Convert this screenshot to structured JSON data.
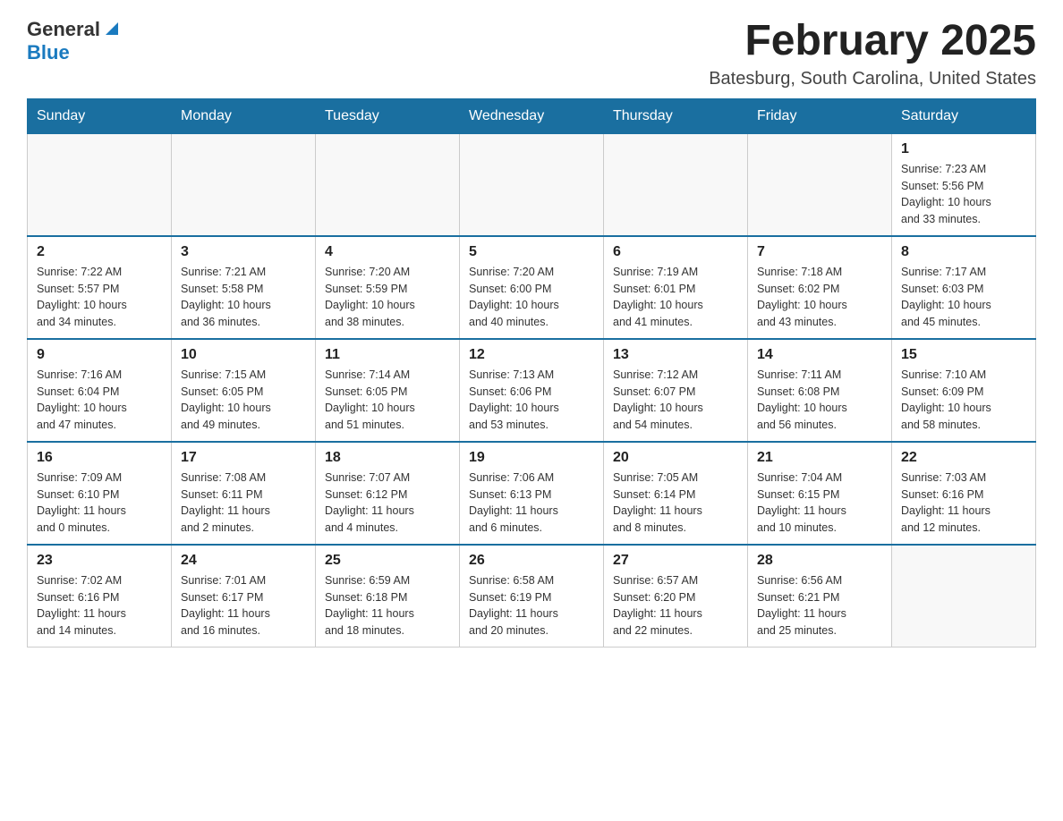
{
  "header": {
    "logo_general": "General",
    "logo_blue": "Blue",
    "title": "February 2025",
    "subtitle": "Batesburg, South Carolina, United States"
  },
  "days_of_week": [
    "Sunday",
    "Monday",
    "Tuesday",
    "Wednesday",
    "Thursday",
    "Friday",
    "Saturday"
  ],
  "weeks": [
    [
      {
        "day": "",
        "info": ""
      },
      {
        "day": "",
        "info": ""
      },
      {
        "day": "",
        "info": ""
      },
      {
        "day": "",
        "info": ""
      },
      {
        "day": "",
        "info": ""
      },
      {
        "day": "",
        "info": ""
      },
      {
        "day": "1",
        "info": "Sunrise: 7:23 AM\nSunset: 5:56 PM\nDaylight: 10 hours\nand 33 minutes."
      }
    ],
    [
      {
        "day": "2",
        "info": "Sunrise: 7:22 AM\nSunset: 5:57 PM\nDaylight: 10 hours\nand 34 minutes."
      },
      {
        "day": "3",
        "info": "Sunrise: 7:21 AM\nSunset: 5:58 PM\nDaylight: 10 hours\nand 36 minutes."
      },
      {
        "day": "4",
        "info": "Sunrise: 7:20 AM\nSunset: 5:59 PM\nDaylight: 10 hours\nand 38 minutes."
      },
      {
        "day": "5",
        "info": "Sunrise: 7:20 AM\nSunset: 6:00 PM\nDaylight: 10 hours\nand 40 minutes."
      },
      {
        "day": "6",
        "info": "Sunrise: 7:19 AM\nSunset: 6:01 PM\nDaylight: 10 hours\nand 41 minutes."
      },
      {
        "day": "7",
        "info": "Sunrise: 7:18 AM\nSunset: 6:02 PM\nDaylight: 10 hours\nand 43 minutes."
      },
      {
        "day": "8",
        "info": "Sunrise: 7:17 AM\nSunset: 6:03 PM\nDaylight: 10 hours\nand 45 minutes."
      }
    ],
    [
      {
        "day": "9",
        "info": "Sunrise: 7:16 AM\nSunset: 6:04 PM\nDaylight: 10 hours\nand 47 minutes."
      },
      {
        "day": "10",
        "info": "Sunrise: 7:15 AM\nSunset: 6:05 PM\nDaylight: 10 hours\nand 49 minutes."
      },
      {
        "day": "11",
        "info": "Sunrise: 7:14 AM\nSunset: 6:05 PM\nDaylight: 10 hours\nand 51 minutes."
      },
      {
        "day": "12",
        "info": "Sunrise: 7:13 AM\nSunset: 6:06 PM\nDaylight: 10 hours\nand 53 minutes."
      },
      {
        "day": "13",
        "info": "Sunrise: 7:12 AM\nSunset: 6:07 PM\nDaylight: 10 hours\nand 54 minutes."
      },
      {
        "day": "14",
        "info": "Sunrise: 7:11 AM\nSunset: 6:08 PM\nDaylight: 10 hours\nand 56 minutes."
      },
      {
        "day": "15",
        "info": "Sunrise: 7:10 AM\nSunset: 6:09 PM\nDaylight: 10 hours\nand 58 minutes."
      }
    ],
    [
      {
        "day": "16",
        "info": "Sunrise: 7:09 AM\nSunset: 6:10 PM\nDaylight: 11 hours\nand 0 minutes."
      },
      {
        "day": "17",
        "info": "Sunrise: 7:08 AM\nSunset: 6:11 PM\nDaylight: 11 hours\nand 2 minutes."
      },
      {
        "day": "18",
        "info": "Sunrise: 7:07 AM\nSunset: 6:12 PM\nDaylight: 11 hours\nand 4 minutes."
      },
      {
        "day": "19",
        "info": "Sunrise: 7:06 AM\nSunset: 6:13 PM\nDaylight: 11 hours\nand 6 minutes."
      },
      {
        "day": "20",
        "info": "Sunrise: 7:05 AM\nSunset: 6:14 PM\nDaylight: 11 hours\nand 8 minutes."
      },
      {
        "day": "21",
        "info": "Sunrise: 7:04 AM\nSunset: 6:15 PM\nDaylight: 11 hours\nand 10 minutes."
      },
      {
        "day": "22",
        "info": "Sunrise: 7:03 AM\nSunset: 6:16 PM\nDaylight: 11 hours\nand 12 minutes."
      }
    ],
    [
      {
        "day": "23",
        "info": "Sunrise: 7:02 AM\nSunset: 6:16 PM\nDaylight: 11 hours\nand 14 minutes."
      },
      {
        "day": "24",
        "info": "Sunrise: 7:01 AM\nSunset: 6:17 PM\nDaylight: 11 hours\nand 16 minutes."
      },
      {
        "day": "25",
        "info": "Sunrise: 6:59 AM\nSunset: 6:18 PM\nDaylight: 11 hours\nand 18 minutes."
      },
      {
        "day": "26",
        "info": "Sunrise: 6:58 AM\nSunset: 6:19 PM\nDaylight: 11 hours\nand 20 minutes."
      },
      {
        "day": "27",
        "info": "Sunrise: 6:57 AM\nSunset: 6:20 PM\nDaylight: 11 hours\nand 22 minutes."
      },
      {
        "day": "28",
        "info": "Sunrise: 6:56 AM\nSunset: 6:21 PM\nDaylight: 11 hours\nand 25 minutes."
      },
      {
        "day": "",
        "info": ""
      }
    ]
  ]
}
